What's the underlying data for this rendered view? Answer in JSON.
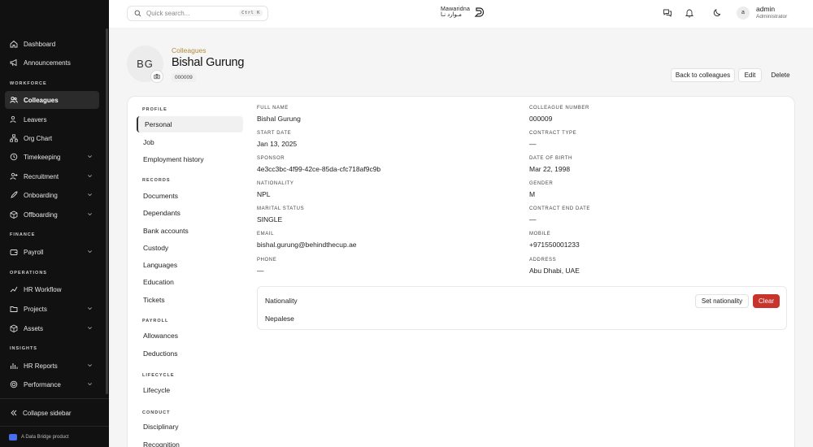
{
  "sidebar": {
    "items_top": [
      {
        "label": "Dashboard",
        "icon": "home-icon"
      },
      {
        "label": "Announcements",
        "icon": "megaphone-icon"
      }
    ],
    "sections": {
      "workforce": "WORKFORCE",
      "finance": "FINANCE",
      "operations": "OPERATIONS",
      "insights": "INSIGHTS"
    },
    "workforce_items": [
      {
        "label": "Colleagues",
        "active": true
      },
      {
        "label": "Leavers"
      },
      {
        "label": "Org Chart"
      },
      {
        "label": "Timekeeping"
      },
      {
        "label": "Recruitment"
      },
      {
        "label": "Onboarding"
      },
      {
        "label": "Offboarding"
      }
    ],
    "finance_items": [
      {
        "label": "Payroll"
      }
    ],
    "operations_items": [
      {
        "label": "HR Workflow"
      },
      {
        "label": "Projects"
      },
      {
        "label": "Assets"
      }
    ],
    "insights_items": [
      {
        "label": "HR Reports"
      },
      {
        "label": "Performance"
      }
    ],
    "collapse_label": "Collapse sidebar",
    "footer": "A Data Bridge product"
  },
  "topbar": {
    "search_placeholder": "Quick search...",
    "search_shortcut": "Ctrl K",
    "brand_en": "Mawaridna",
    "brand_ar": "مـوارد نـا",
    "user_initial": "a",
    "user_name": "admin",
    "user_role": "Administrator"
  },
  "header": {
    "initials": "BG",
    "breadcrumb": "Colleagues",
    "name": "Bishal Gurung",
    "number_badge": "000009",
    "back_label": "Back to colleagues",
    "edit_label": "Edit",
    "delete_label": "Delete"
  },
  "nav": {
    "profile_section": "PROFILE",
    "profile_items": [
      "Personal",
      "Job",
      "Employment history"
    ],
    "records_section": "RECORDS",
    "records_items": [
      "Documents",
      "Dependants",
      "Bank accounts",
      "Custody",
      "Languages",
      "Education",
      "Tickets"
    ],
    "payroll_section": "PAYROLL",
    "payroll_items": [
      "Allowances",
      "Deductions"
    ],
    "lifecycle_section": "LIFECYCLE",
    "lifecycle_items": [
      "Lifecycle"
    ],
    "conduct_section": "CONDUCT",
    "conduct_items": [
      "Disciplinary",
      "Recognition"
    ]
  },
  "fields": {
    "full_name": {
      "label": "FULL NAME",
      "value": "Bishal Gurung"
    },
    "colleague_number": {
      "label": "COLLEAGUE NUMBER",
      "value": "000009"
    },
    "start_date": {
      "label": "START DATE",
      "value": "Jan 13, 2025"
    },
    "contract_type": {
      "label": "CONTRACT TYPE",
      "value": "—"
    },
    "sponsor": {
      "label": "SPONSOR",
      "value": "4e3cc3bc-4f99-42ce-85da-cfc718af9c9b"
    },
    "date_of_birth": {
      "label": "DATE OF BIRTH",
      "value": "Mar 22, 1998"
    },
    "nationality": {
      "label": "NATIONALITY",
      "value": "NPL"
    },
    "gender": {
      "label": "GENDER",
      "value": "M"
    },
    "marital_status": {
      "label": "MARITAL STATUS",
      "value": "SINGLE"
    },
    "contract_end_date": {
      "label": "CONTRACT END DATE",
      "value": "—"
    },
    "email": {
      "label": "EMAIL",
      "value": "bishal.gurung@behindthecup.ae"
    },
    "mobile": {
      "label": "MOBILE",
      "value": "+971550001233"
    },
    "phone": {
      "label": "PHONE",
      "value": "—"
    },
    "address": {
      "label": "ADDRESS",
      "value": "Abu Dhabi, UAE"
    }
  },
  "nationality_panel": {
    "title": "Nationality",
    "value": "Nepalese",
    "set_label": "Set nationality",
    "clear_label": "Clear"
  },
  "colors": {
    "sidebar_bg": "#111111",
    "breadcrumb": "#b58a3a",
    "danger": "#c8332b"
  }
}
